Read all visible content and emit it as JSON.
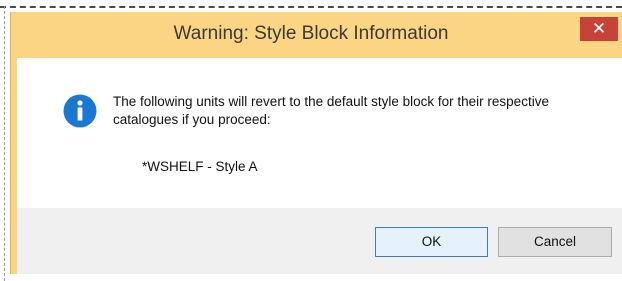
{
  "dialog": {
    "title": "Warning: Style Block Information",
    "close_glyph": "✕",
    "message": "The following units will revert to the default style block for their respective catalogues if you proceed:",
    "units": [
      "*WSHELF - Style A"
    ],
    "buttons": {
      "ok_label": "OK",
      "cancel_label": "Cancel"
    },
    "icon": "info-icon"
  },
  "colors": {
    "titlebar": "#fbd583",
    "close_button": "#c7433a",
    "info_icon": "#1a78d2",
    "footer": "#f0f0f0"
  }
}
